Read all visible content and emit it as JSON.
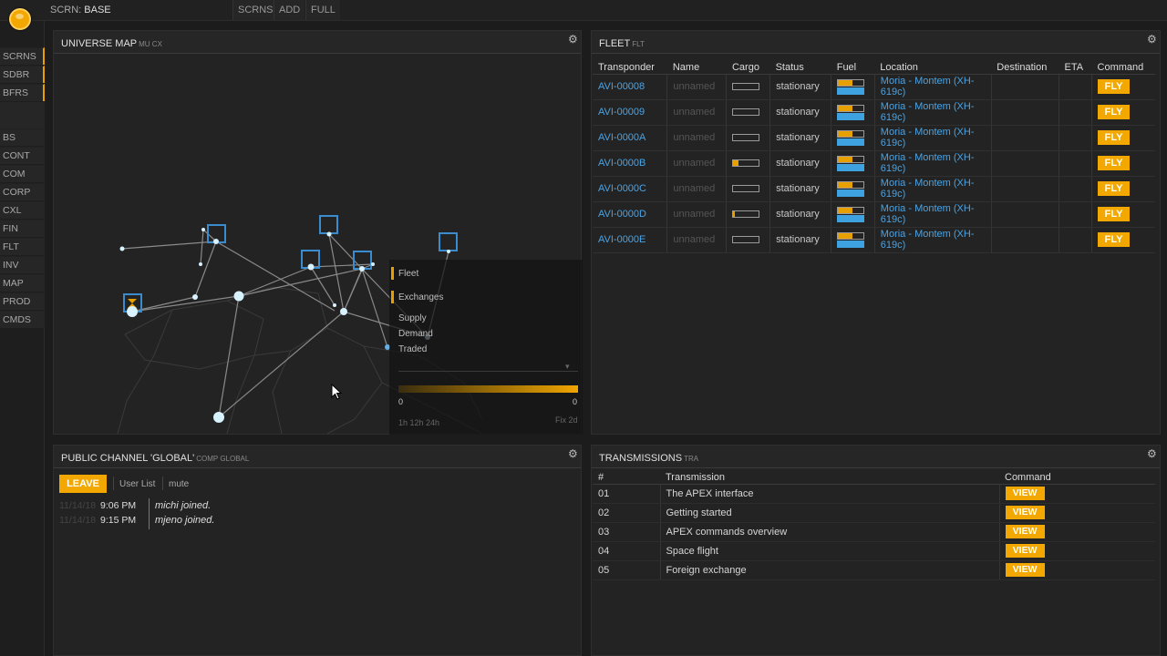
{
  "topbar": {
    "scrn_prefix": "SCRN:",
    "scrn_name": "BASE",
    "buttons": [
      "SCRNS",
      "ADD",
      "FULL"
    ]
  },
  "leftnav": {
    "top_items": [
      "SCRNS",
      "SDBR",
      "BFRS"
    ],
    "items": [
      "BS",
      "CONT",
      "COM",
      "CORP",
      "CXL",
      "FIN",
      "FLT",
      "INV",
      "MAP",
      "PROD",
      "CMDS"
    ]
  },
  "map_panel": {
    "title": "UNIVERSE MAP",
    "subtitle": "MU CX",
    "legend": {
      "fleet": "Fleet",
      "exchanges": "Exchanges",
      "supply": "Supply",
      "demand": "Demand",
      "traded": "Traded",
      "range_min": "0",
      "range_max": "0",
      "periods": "1h  12h  24h",
      "fix": "Fix 2d"
    }
  },
  "fleet_panel": {
    "title": "FLEET",
    "subtitle": "FLT",
    "columns": [
      "Transponder",
      "Name",
      "Cargo",
      "Status",
      "Fuel",
      "Location",
      "Destination",
      "ETA",
      "Command"
    ],
    "rows": [
      {
        "transponder": "AVI-00008",
        "name": "unnamed",
        "cargo": 0,
        "status": "stationary",
        "location": "Moria - Montem (XH-619c)",
        "command": "FLY"
      },
      {
        "transponder": "AVI-00009",
        "name": "unnamed",
        "cargo": 0,
        "status": "stationary",
        "location": "Moria - Montem (XH-619c)",
        "command": "FLY"
      },
      {
        "transponder": "AVI-0000A",
        "name": "unnamed",
        "cargo": 0,
        "status": "stationary",
        "location": "Moria - Montem (XH-619c)",
        "command": "FLY"
      },
      {
        "transponder": "AVI-0000B",
        "name": "unnamed",
        "cargo": 0.2,
        "status": "stationary",
        "location": "Moria - Montem (XH-619c)",
        "command": "FLY"
      },
      {
        "transponder": "AVI-0000C",
        "name": "unnamed",
        "cargo": 0,
        "status": "stationary",
        "location": "Moria - Montem (XH-619c)",
        "command": "FLY"
      },
      {
        "transponder": "AVI-0000D",
        "name": "unnamed",
        "cargo": 0.05,
        "status": "stationary",
        "location": "Moria - Montem (XH-619c)",
        "command": "FLY"
      },
      {
        "transponder": "AVI-0000E",
        "name": "unnamed",
        "cargo": 0,
        "status": "stationary",
        "location": "Moria - Montem (XH-619c)",
        "command": "FLY"
      }
    ]
  },
  "chat_panel": {
    "title": "PUBLIC CHANNEL 'GLOBAL'",
    "subtitle": "COMP GLOBAL",
    "leave_label": "LEAVE",
    "user_list_label": "User List",
    "mute_label": "mute",
    "messages": [
      {
        "date": "11/14/18",
        "time": "9:06 PM",
        "text": "michi joined."
      },
      {
        "date": "11/14/18",
        "time": "9:15 PM",
        "text": "mjeno joined."
      }
    ]
  },
  "tra_panel": {
    "title": "TRANSMISSIONS",
    "subtitle": "TRA",
    "columns": [
      "#",
      "Transmission",
      "Command"
    ],
    "rows": [
      {
        "num": "01",
        "title": "The APEX interface",
        "command": "VIEW"
      },
      {
        "num": "02",
        "title": "Getting started",
        "command": "VIEW"
      },
      {
        "num": "03",
        "title": "APEX commands overview",
        "command": "VIEW"
      },
      {
        "num": "04",
        "title": "Space flight",
        "command": "VIEW"
      },
      {
        "num": "05",
        "title": "Foreign exchange",
        "command": "VIEW"
      }
    ]
  },
  "colors": {
    "accent": "#f2a800",
    "link": "#4aa3e4",
    "fuel_blue": "#3ea1e0"
  }
}
